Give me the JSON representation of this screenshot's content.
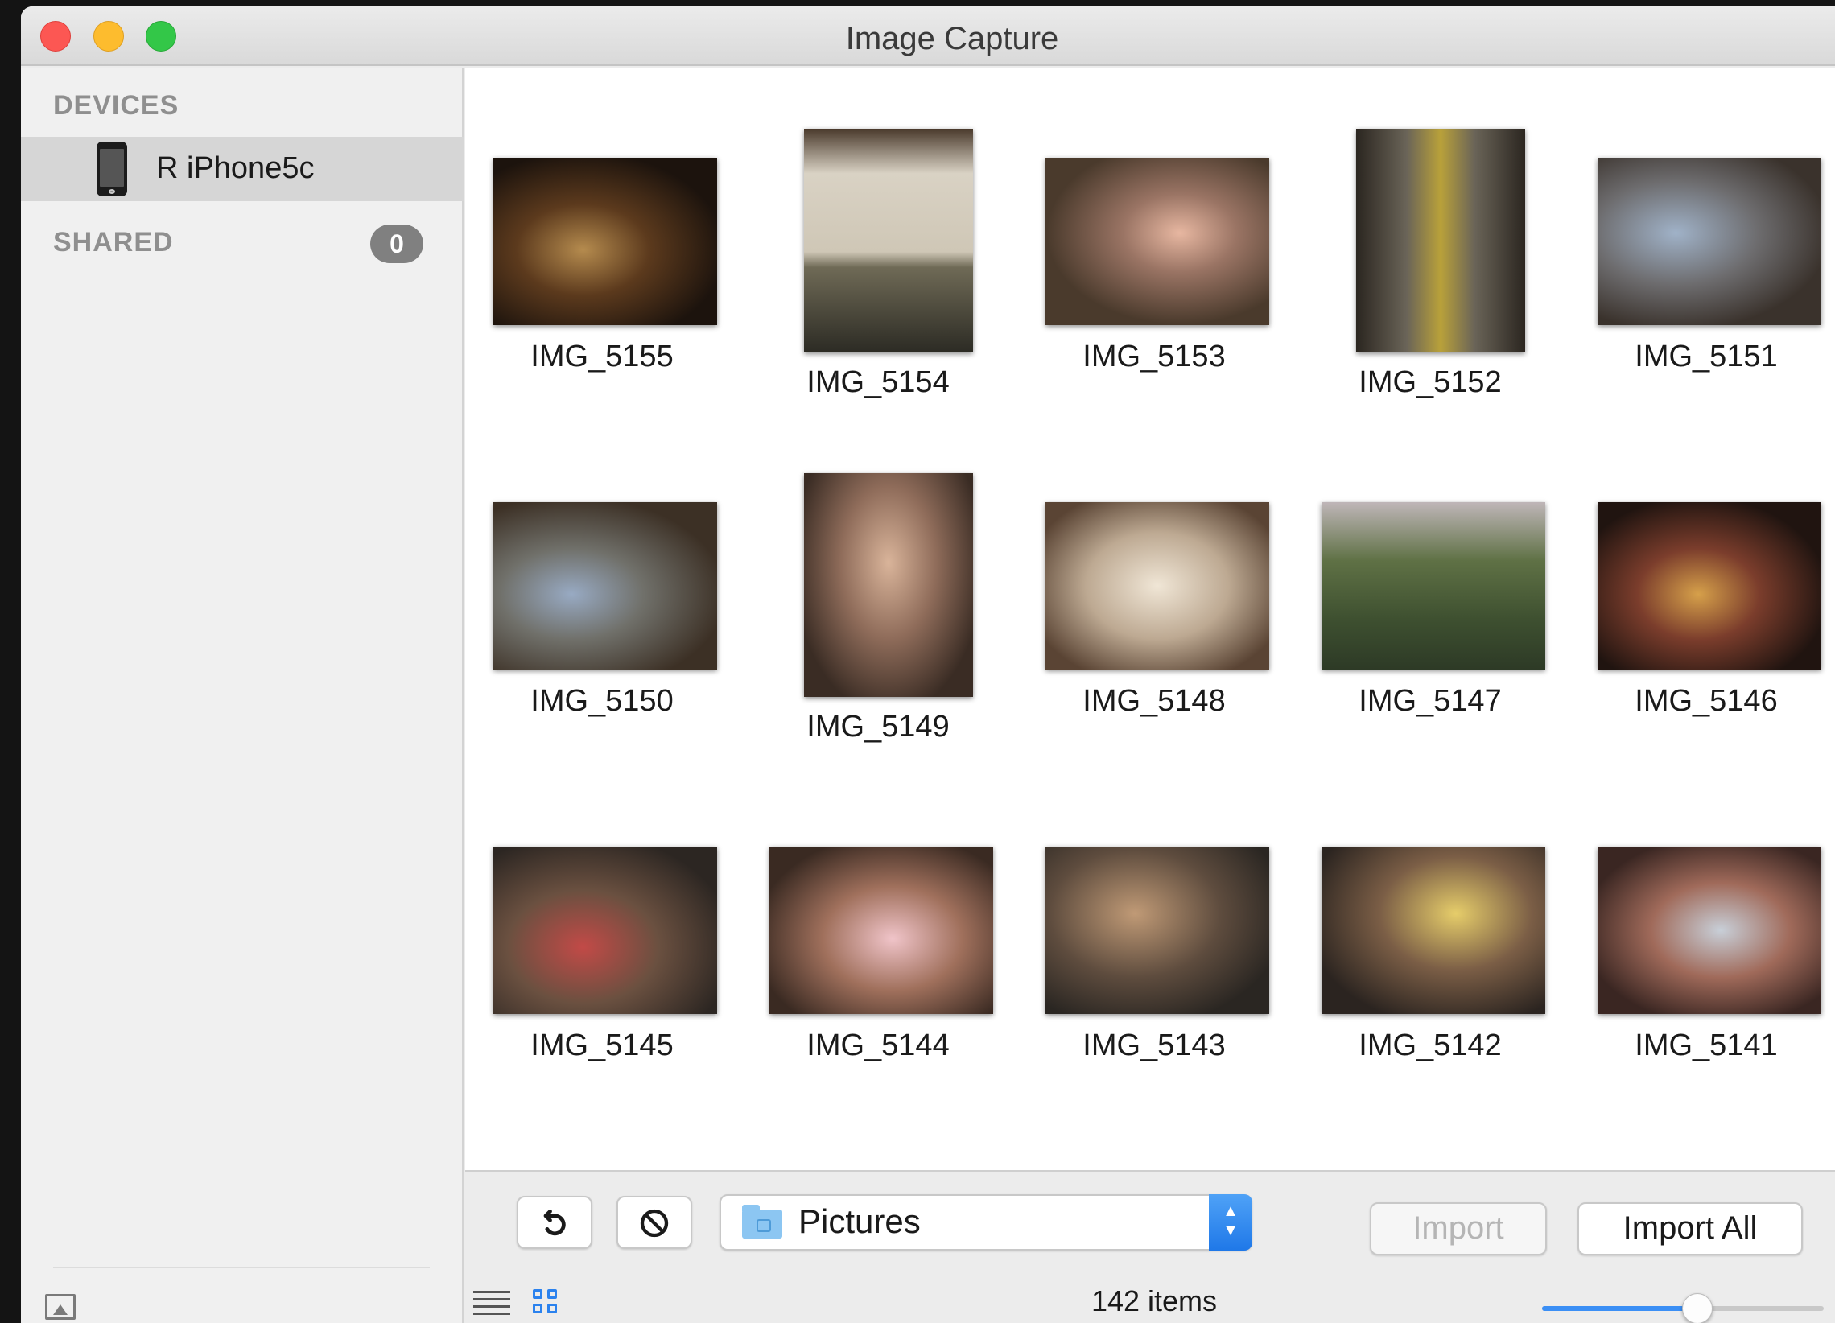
{
  "window": {
    "title": "Image Capture"
  },
  "sidebar": {
    "devices_header": "DEVICES",
    "device_name": "R iPhone5c",
    "shared_header": "SHARED",
    "shared_count": "0"
  },
  "photos": [
    {
      "name": "IMG_5155",
      "orientation": "landscape"
    },
    {
      "name": "IMG_5154",
      "orientation": "portrait"
    },
    {
      "name": "IMG_5153",
      "orientation": "landscape"
    },
    {
      "name": "IMG_5152",
      "orientation": "portrait"
    },
    {
      "name": "IMG_5151",
      "orientation": "landscape"
    },
    {
      "name": "IMG_5150",
      "orientation": "landscape"
    },
    {
      "name": "IMG_5149",
      "orientation": "portrait"
    },
    {
      "name": "IMG_5148",
      "orientation": "landscape"
    },
    {
      "name": "IMG_5147",
      "orientation": "landscape"
    },
    {
      "name": "IMG_5146",
      "orientation": "landscape"
    },
    {
      "name": "IMG_5145",
      "orientation": "landscape"
    },
    {
      "name": "IMG_5144",
      "orientation": "landscape"
    },
    {
      "name": "IMG_5143",
      "orientation": "landscape"
    },
    {
      "name": "IMG_5142",
      "orientation": "landscape"
    },
    {
      "name": "IMG_5141",
      "orientation": "landscape"
    }
  ],
  "toolbar": {
    "destination": "Pictures",
    "import_label": "Import",
    "import_all_label": "Import All",
    "item_count": "142 items",
    "thumbnail_size_fraction": 0.55
  }
}
